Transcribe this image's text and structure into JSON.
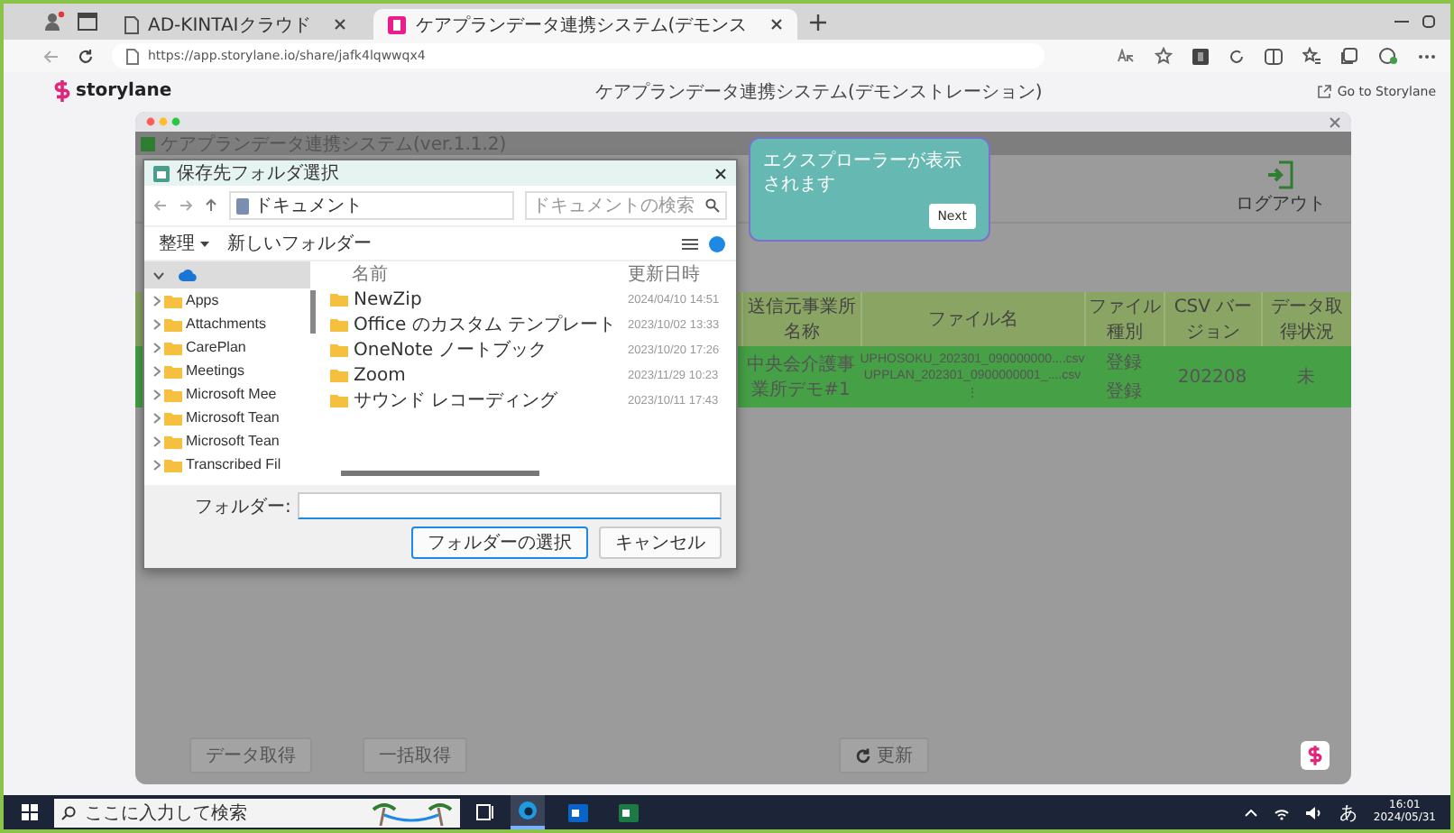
{
  "browser": {
    "tabs": [
      {
        "title": "AD-KINTAIクラウド",
        "selected": false
      },
      {
        "title": "ケアプランデータ連携システム(デモンス",
        "selected": true
      }
    ],
    "url": "https://app.storylane.io/share/jafk4lqwwqx4"
  },
  "storylane": {
    "logo": "storylane",
    "title": "ケアプランデータ連携システム(デモンストレーション)",
    "link": "Go to Storylane"
  },
  "app": {
    "title": "ケアプランデータ連携システム(ver.1.1.2)",
    "logout": "ログアウト",
    "table": {
      "columns": [
        "送信元事業所名称",
        "ファイル名",
        "ファイル種別",
        "CSV バージョン",
        "データ取得状況"
      ],
      "rows": [
        {
          "selected": true,
          "sender": "中央会介護事業所デモ#1",
          "files": [
            "UPHOSOKU_202301_090000000....csv",
            "UPPLAN_202301_0900000001_....csv",
            "⋮"
          ],
          "types": [
            "登録",
            "登録"
          ],
          "version": "202208",
          "status": "未"
        }
      ]
    },
    "buttons": [
      {
        "label": "データ取得",
        "kind": "plain"
      },
      {
        "label": "一括取得",
        "kind": "plain"
      },
      {
        "label": "更新",
        "kind": "refresh"
      }
    ]
  },
  "dialog": {
    "title": "保存先フォルダ選択",
    "path": "ドキュメント",
    "search_placeholder": "ドキュメントの検索",
    "organize": "整理",
    "new_folder": "新しいフォルダー",
    "tree": {
      "selected": true,
      "expanded": true,
      "children": [
        {
          "label": "Apps",
          "selected": false
        },
        {
          "label": "Attachments",
          "selected": false
        },
        {
          "label": "CarePlan",
          "selected": false
        },
        {
          "label": "Meetings",
          "selected": false
        },
        {
          "label": "Microsoft Mee",
          "selected": false
        },
        {
          "label": "Microsoft Tean",
          "selected": false
        },
        {
          "label": "Microsoft Tean",
          "selected": false
        },
        {
          "label": "Transcribed Fil",
          "selected": false
        }
      ]
    },
    "columns": [
      "名前",
      "更新日時"
    ],
    "files": [
      {
        "name": "NewZip",
        "modified": "2024/04/10 14:51"
      },
      {
        "name": "Office のカスタム テンプレート",
        "modified": "2023/10/02 13:33"
      },
      {
        "name": "OneNote ノートブック",
        "modified": "2023/10/20 17:26"
      },
      {
        "name": "Zoom",
        "modified": "2023/11/29 10:23"
      },
      {
        "name": "サウンド レコーディング",
        "modified": "2023/10/11 17:43"
      }
    ],
    "folder_label": "フォルダー:",
    "buttons": [
      "フォルダーの選択",
      "キャンセル"
    ]
  },
  "tooltip": {
    "text": "エクスプローラーが表示されます",
    "button": "Next"
  },
  "taskbar": {
    "search_placeholder": "ここに入力して検索",
    "ime": "あ",
    "time": "16:01",
    "date": "2024/05/31"
  }
}
